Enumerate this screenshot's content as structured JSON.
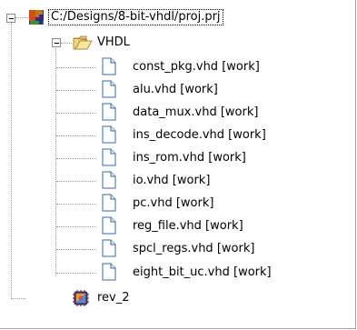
{
  "tree": {
    "project": {
      "label": "C:/Designs/8-bit-vhdl/proj.prj"
    },
    "folder": {
      "label": "VHDL"
    },
    "files": [
      {
        "label": "const_pkg.vhd [work]"
      },
      {
        "label": "alu.vhd [work]"
      },
      {
        "label": "data_mux.vhd [work]"
      },
      {
        "label": "ins_decode.vhd [work]"
      },
      {
        "label": "ins_rom.vhd [work]"
      },
      {
        "label": "io.vhd [work]"
      },
      {
        "label": "pc.vhd [work]"
      },
      {
        "label": "reg_file.vhd [work]"
      },
      {
        "label": "spcl_regs.vhd [work]"
      },
      {
        "label": "eight_bit_uc.vhd [work]"
      }
    ],
    "revision": {
      "label": "rev_2"
    }
  },
  "icons": {
    "project": "project-chip-icon",
    "folder": "open-folder-icon",
    "file": "document-icon",
    "revision": "revision-chip-icon",
    "expander": "collapse-minus-icon"
  }
}
